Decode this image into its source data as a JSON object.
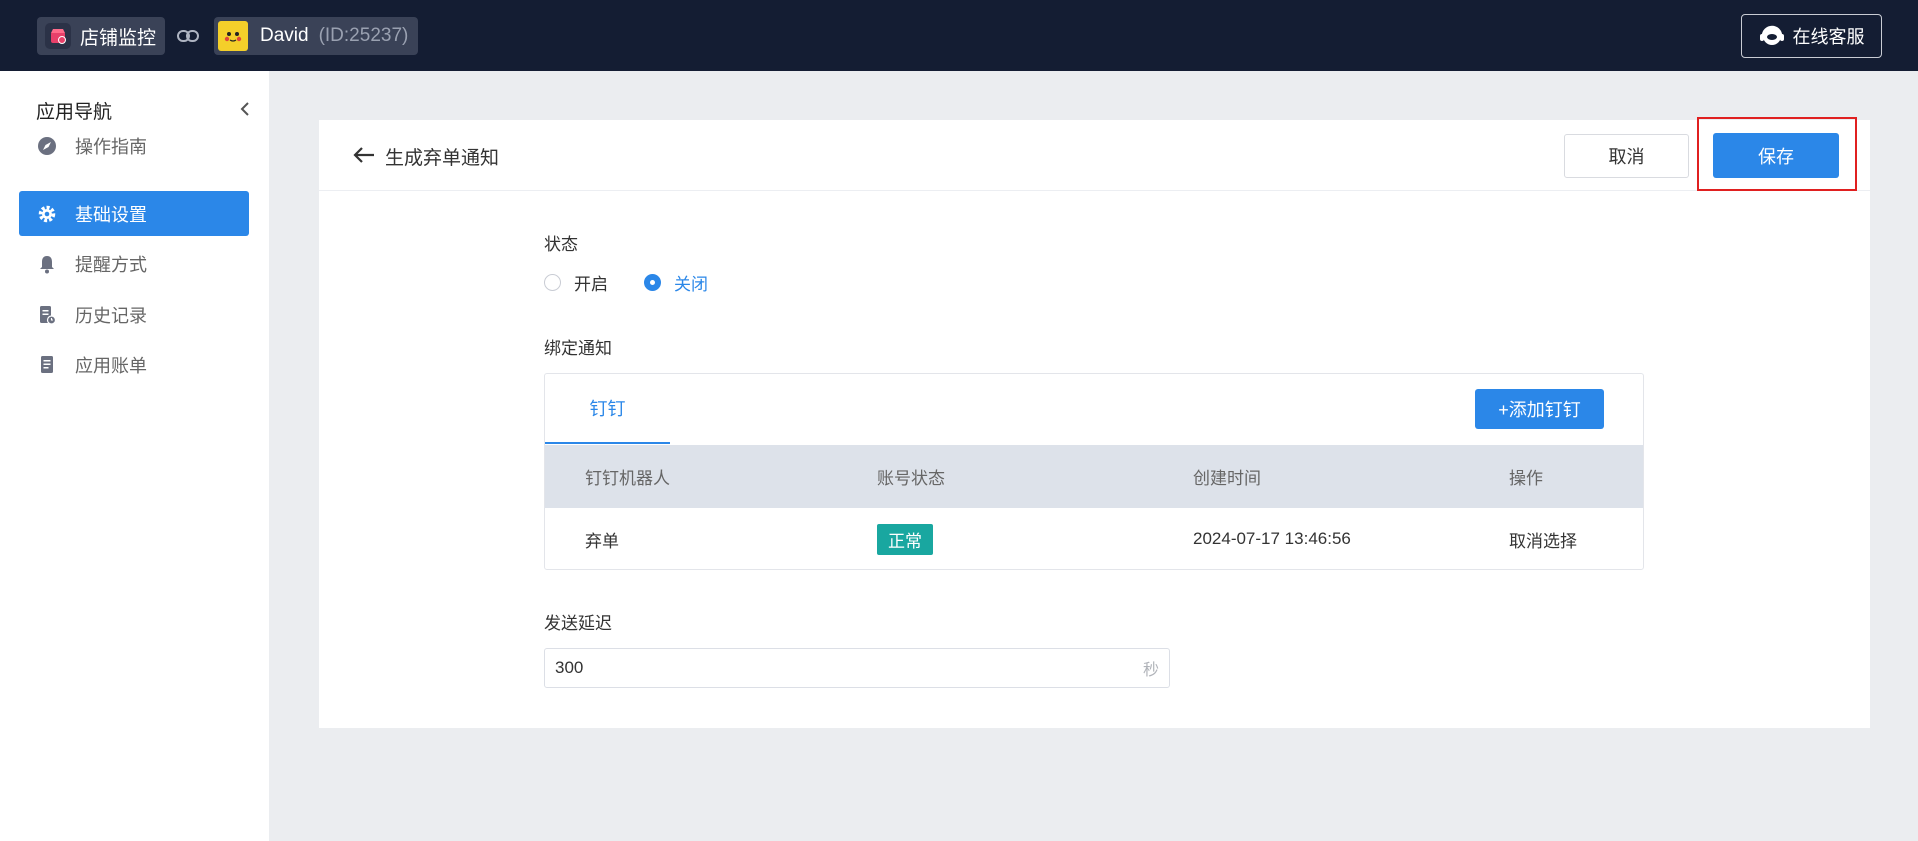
{
  "header": {
    "shop_name": "店铺监控",
    "user_name": "David",
    "user_id": "(ID:25237)",
    "service_label": "在线客服"
  },
  "sidebar": {
    "title": "应用导航",
    "items": [
      {
        "label": "操作指南",
        "icon": "navigation-icon"
      },
      {
        "label": "基础设置",
        "icon": "gear-icon",
        "active": true
      },
      {
        "label": "提醒方式",
        "icon": "bell-icon"
      },
      {
        "label": "历史记录",
        "icon": "history-doc-icon"
      },
      {
        "label": "应用账单",
        "icon": "bill-icon"
      }
    ]
  },
  "page": {
    "title": "生成弃单通知",
    "cancel_label": "取消",
    "save_label": "保存"
  },
  "form": {
    "status_label": "状态",
    "status_options": [
      "开启",
      "关闭"
    ],
    "status_selected": "关闭",
    "bind_label": "绑定通知",
    "tab_label": "钉钉",
    "add_button": "+添加钉钉",
    "table": {
      "headers": [
        "钉钉机器人",
        "账号状态",
        "创建时间",
        "操作"
      ],
      "rows": [
        {
          "robot": "弃单",
          "status": "正常",
          "created": "2024-07-17 13:46:56",
          "action": "取消选择"
        }
      ]
    },
    "delay_label": "发送延迟",
    "delay_value": "300",
    "delay_unit": "秒"
  },
  "colors": {
    "topbar": "#141d33",
    "primary": "#2b87e8",
    "status_ok": "#19a7a0",
    "highlight": "#e02020"
  }
}
